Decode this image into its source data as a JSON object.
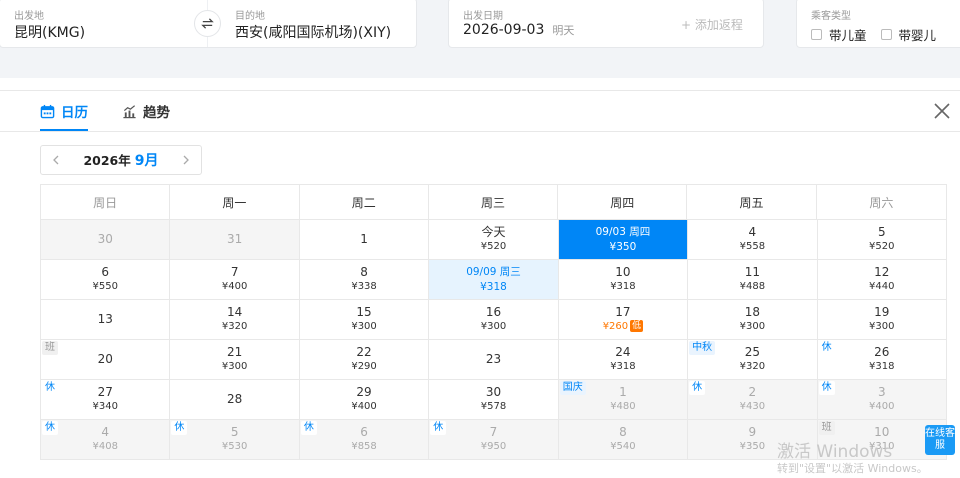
{
  "search": {
    "origin_label": "出发地",
    "origin_value": "昆明(KMG)",
    "destination_label": "目的地",
    "destination_value": "西安(咸阳国际机场)(XIY)",
    "date_label": "出发日期",
    "date_value": "2026-09-03",
    "date_weekday": "明天",
    "add_return": "+ 添加返程",
    "passenger_label": "乘客类型",
    "passenger_options": [
      "带儿童",
      "带婴儿"
    ]
  },
  "tabs": [
    {
      "label": "日历",
      "icon": "calendar-icon",
      "active": true
    },
    {
      "label": "趋势",
      "icon": "trend-chart-icon",
      "active": false
    }
  ],
  "calendar": {
    "year_label": "2026年",
    "month_label": "9月",
    "weekdays": [
      "周日",
      "周一",
      "周二",
      "周三",
      "周四",
      "周五",
      "周六"
    ],
    "cells": [
      {
        "day": "30",
        "price": "",
        "state": "other",
        "tag": ""
      },
      {
        "day": "31",
        "price": "",
        "state": "other",
        "tag": ""
      },
      {
        "day": "1",
        "price": "",
        "state": "",
        "tag": ""
      },
      {
        "day": "今天",
        "price": "¥520",
        "state": "",
        "tag": ""
      },
      {
        "day": "09/03 周四",
        "price": "¥350",
        "state": "selected",
        "tag": ""
      },
      {
        "day": "4",
        "price": "¥558",
        "state": "",
        "tag": ""
      },
      {
        "day": "5",
        "price": "¥520",
        "state": "",
        "tag": ""
      },
      {
        "day": "6",
        "price": "¥550",
        "state": "",
        "tag": ""
      },
      {
        "day": "7",
        "price": "¥400",
        "state": "",
        "tag": ""
      },
      {
        "day": "8",
        "price": "¥338",
        "state": "",
        "tag": ""
      },
      {
        "day": "09/09 周三",
        "price": "¥318",
        "state": "return",
        "tag": ""
      },
      {
        "day": "10",
        "price": "¥318",
        "state": "",
        "tag": ""
      },
      {
        "day": "11",
        "price": "¥488",
        "state": "",
        "tag": ""
      },
      {
        "day": "12",
        "price": "¥440",
        "state": "",
        "tag": ""
      },
      {
        "day": "13",
        "price": "",
        "state": "",
        "tag": ""
      },
      {
        "day": "14",
        "price": "¥320",
        "state": "",
        "tag": ""
      },
      {
        "day": "15",
        "price": "¥300",
        "state": "",
        "tag": ""
      },
      {
        "day": "16",
        "price": "¥300",
        "state": "",
        "tag": ""
      },
      {
        "day": "17",
        "price": "¥260",
        "state": "low",
        "tag": "",
        "badge": "低"
      },
      {
        "day": "18",
        "price": "¥300",
        "state": "",
        "tag": ""
      },
      {
        "day": "19",
        "price": "¥300",
        "state": "",
        "tag": ""
      },
      {
        "day": "20",
        "price": "",
        "state": "",
        "tag": "班",
        "tag_type": "work"
      },
      {
        "day": "21",
        "price": "¥300",
        "state": "",
        "tag": ""
      },
      {
        "day": "22",
        "price": "¥290",
        "state": "",
        "tag": ""
      },
      {
        "day": "23",
        "price": "",
        "state": "",
        "tag": ""
      },
      {
        "day": "24",
        "price": "¥318",
        "state": "",
        "tag": ""
      },
      {
        "day": "25",
        "price": "¥320",
        "state": "",
        "tag": "中秋",
        "tag_type": "festival"
      },
      {
        "day": "26",
        "price": "¥318",
        "state": "",
        "tag": "休",
        "tag_type": "rest"
      },
      {
        "day": "27",
        "price": "¥340",
        "state": "",
        "tag": "休",
        "tag_type": "rest"
      },
      {
        "day": "28",
        "price": "",
        "state": "",
        "tag": ""
      },
      {
        "day": "29",
        "price": "¥400",
        "state": "",
        "tag": ""
      },
      {
        "day": "30",
        "price": "¥578",
        "state": "",
        "tag": ""
      },
      {
        "day": "1",
        "price": "¥480",
        "state": "other",
        "tag": "国庆",
        "tag_type": "festival"
      },
      {
        "day": "2",
        "price": "¥430",
        "state": "other",
        "tag": "休",
        "tag_type": "rest"
      },
      {
        "day": "3",
        "price": "¥400",
        "state": "other",
        "tag": "休",
        "tag_type": "rest"
      },
      {
        "day": "4",
        "price": "¥408",
        "state": "other",
        "tag": "休",
        "tag_type": "rest"
      },
      {
        "day": "5",
        "price": "¥530",
        "state": "other",
        "tag": "休",
        "tag_type": "rest"
      },
      {
        "day": "6",
        "price": "¥858",
        "state": "other",
        "tag": "休",
        "tag_type": "rest"
      },
      {
        "day": "7",
        "price": "¥950",
        "state": "other",
        "tag": "休",
        "tag_type": "rest"
      },
      {
        "day": "8",
        "price": "¥540",
        "state": "other",
        "tag": ""
      },
      {
        "day": "9",
        "price": "¥350",
        "state": "other",
        "tag": ""
      },
      {
        "day": "10",
        "price": "¥310",
        "state": "other",
        "tag": "班",
        "tag_type": "work"
      }
    ]
  },
  "customer_service": "在线客服",
  "watermark": {
    "line1": "激活 Windows",
    "line2": "转到\"设置\"以激活 Windows。"
  },
  "colors": {
    "accent": "#0086f6",
    "low_price": "#ff7700"
  }
}
